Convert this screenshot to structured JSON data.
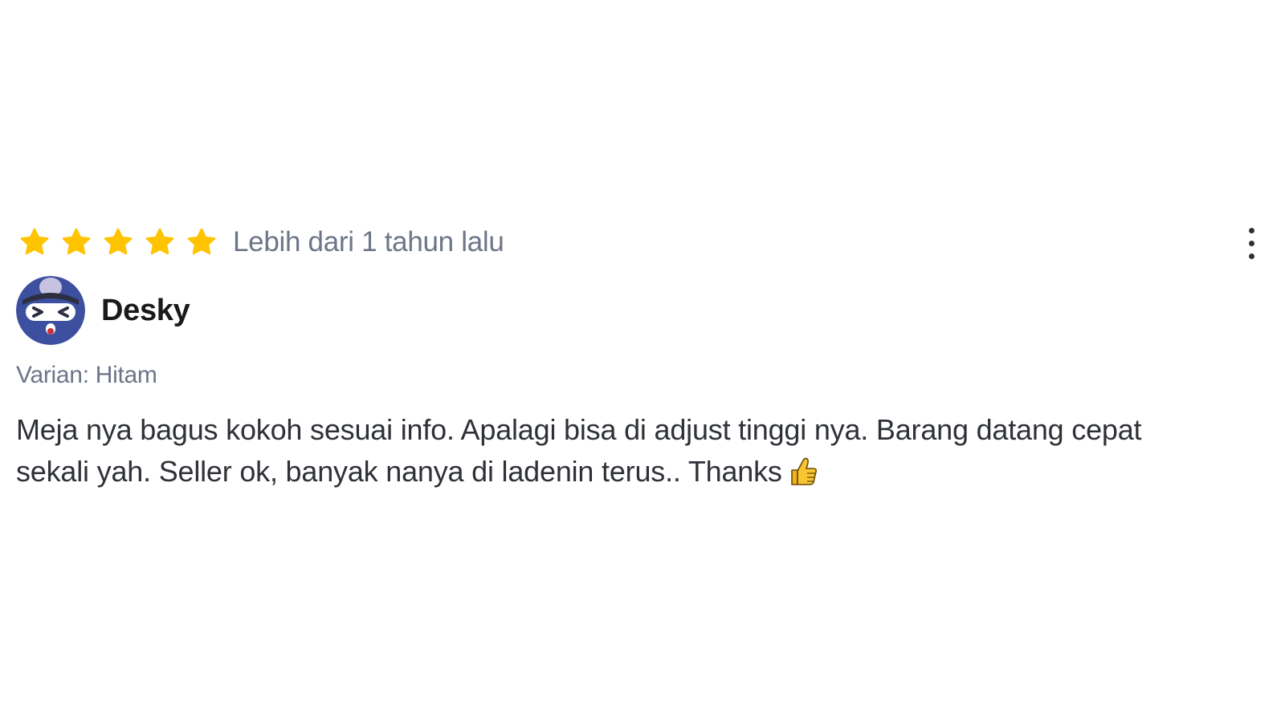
{
  "review": {
    "rating": 5,
    "rating_max": 5,
    "star_color": "#FFC400",
    "timestamp": "Lebih dari 1 tahun lalu",
    "more_icon": "more-vertical-icon",
    "user": {
      "name": "Desky",
      "avatar_icon": "cartoon-avatar"
    },
    "variant": "Varian: Hitam",
    "text": "Meja nya bagus kokoh sesuai info. Apalagi bisa di adjust tinggi nya. Barang datang cepat sekali yah. Seller ok, banyak nanya di ladenin terus.. Thanks",
    "emoji": "thumbs-up-icon"
  }
}
